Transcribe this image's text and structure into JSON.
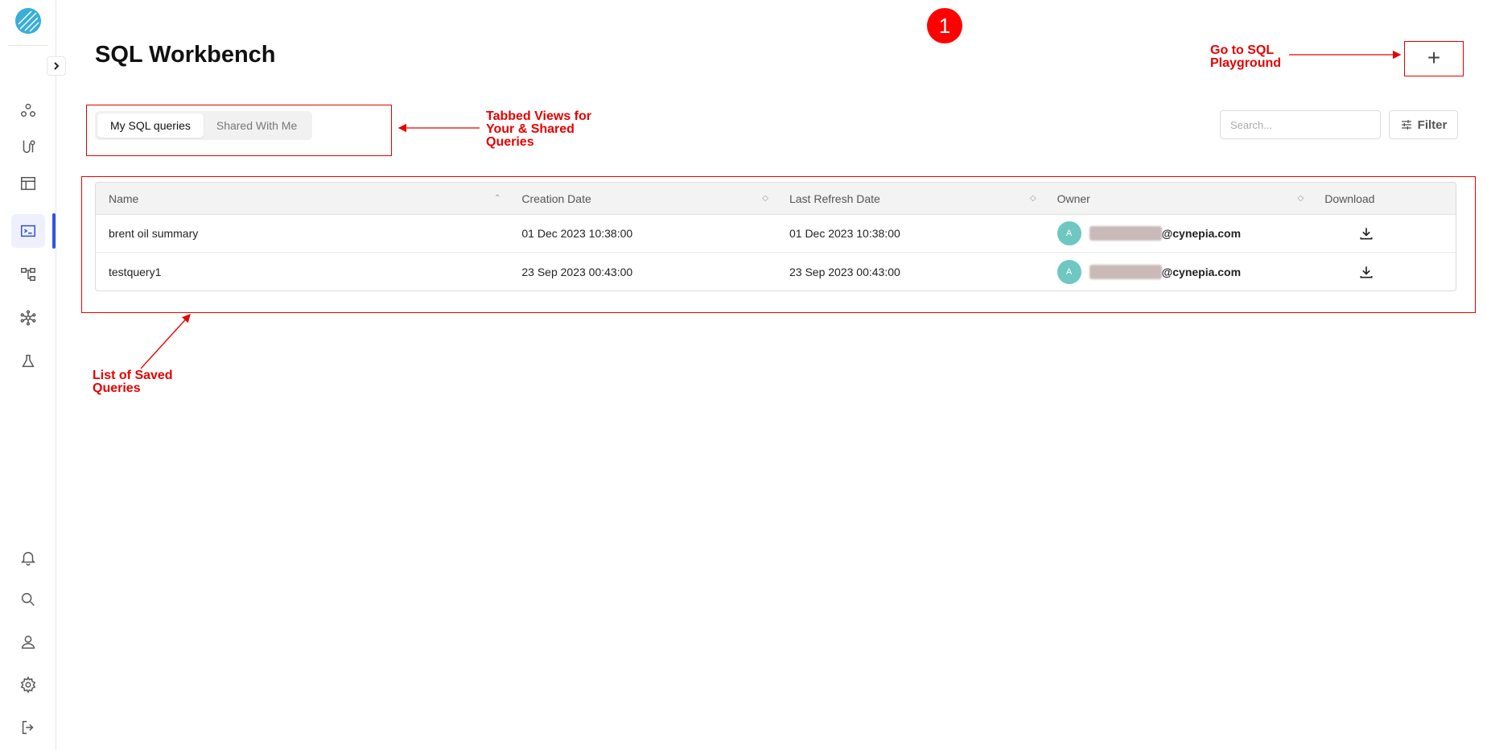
{
  "page": {
    "title": "SQL Workbench",
    "step_number": "1"
  },
  "header": {
    "add_label": "+"
  },
  "tabs": [
    {
      "label": "My SQL queries",
      "active": true
    },
    {
      "label": "Shared With Me",
      "active": false
    }
  ],
  "search": {
    "placeholder": "Search..."
  },
  "filter": {
    "label": "Filter"
  },
  "table": {
    "columns": [
      "Name",
      "Creation Date",
      "Last Refresh Date",
      "Owner",
      "Download"
    ],
    "rows": [
      {
        "name": "brent oil summary",
        "created": "01 Dec 2023 10:38:00",
        "refreshed": "01 Dec 2023 10:38:00",
        "owner_initial": "A",
        "owner_email": "@cynepia.com"
      },
      {
        "name": "testquery1",
        "created": "23 Sep 2023 00:43:00",
        "refreshed": "23 Sep 2023 00:43:00",
        "owner_initial": "A",
        "owner_email": "@cynepia.com"
      }
    ]
  },
  "annotations": {
    "playground": "Go to SQL Playground",
    "tabs": "Tabbed Views for Your & Shared Queries",
    "list": "List of Saved Queries",
    "color": "#e60000"
  },
  "sidebar": {
    "icons": [
      "dataset-icon",
      "pipeline-icon",
      "table-icon",
      "sql-terminal-icon",
      "lineage-icon",
      "network-icon",
      "lab-flask-icon",
      "bell-icon",
      "search-icon",
      "user-icon",
      "gear-icon",
      "logout-icon"
    ],
    "active": "sql-terminal-icon",
    "accent": "#3355e0"
  }
}
